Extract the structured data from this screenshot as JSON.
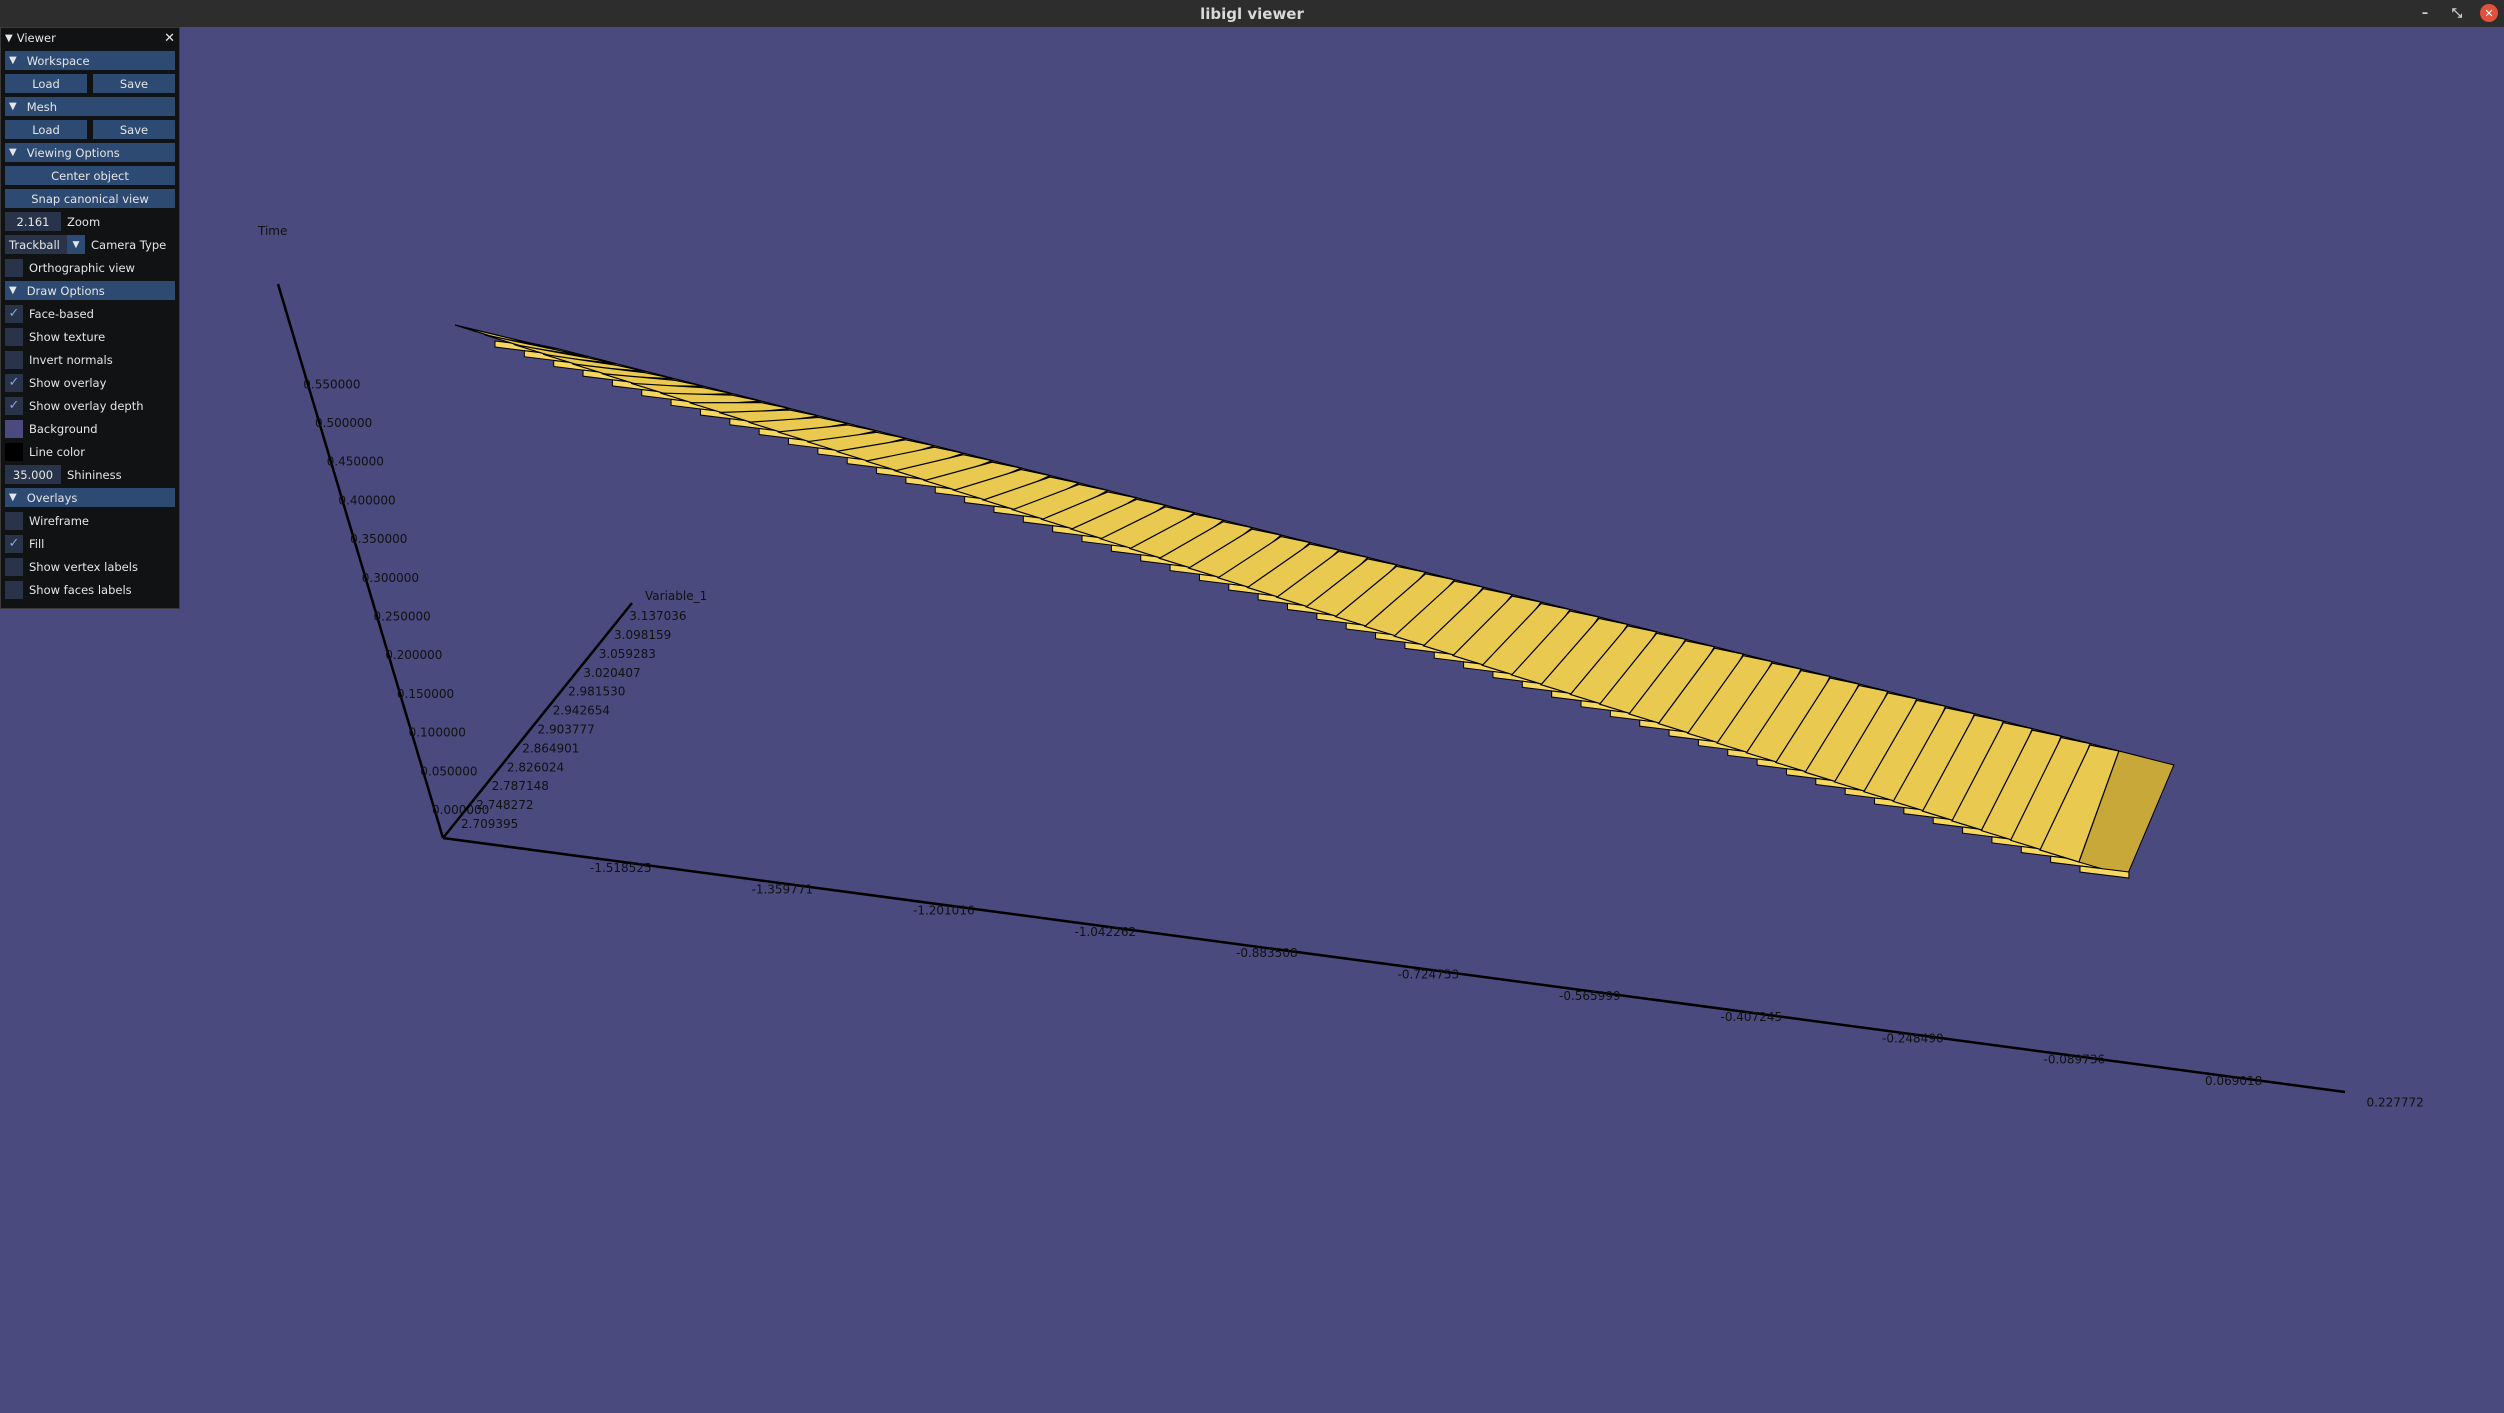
{
  "window": {
    "title": "libigl viewer"
  },
  "panel": {
    "title": "Viewer",
    "workspace": {
      "label": "Workspace",
      "load": "Load",
      "save": "Save"
    },
    "mesh": {
      "label": "Mesh",
      "load": "Load",
      "save": "Save"
    },
    "viewing": {
      "label": "Viewing Options",
      "center": "Center object",
      "snap": "Snap canonical view",
      "zoom_value": "2.161",
      "zoom_label": "Zoom",
      "camera_value": "Trackball",
      "camera_label": "Camera Type",
      "ortho": "Orthographic view"
    },
    "draw": {
      "label": "Draw Options",
      "face_based": "Face-based",
      "show_texture": "Show texture",
      "invert_normals": "Invert normals",
      "show_overlay": "Show overlay",
      "show_overlay_depth": "Show overlay depth",
      "background": "Background",
      "line_color": "Line color",
      "shininess_value": "35.000",
      "shininess_label": "Shininess",
      "background_color": "#4a4a7e",
      "line_color_value": "#000000"
    },
    "overlays": {
      "label": "Overlays",
      "wireframe": "Wireframe",
      "fill": "Fill",
      "vertex_labels": "Show vertex labels",
      "faces_labels": "Show faces labels"
    }
  },
  "scene": {
    "bar_color": "#e9c94f",
    "bar_count": 55,
    "axis_time": {
      "label": "Time",
      "ticks": [
        "0.000000",
        "0.050000",
        "0.100000",
        "0.150000",
        "0.200000",
        "0.250000",
        "0.300000",
        "0.350000",
        "0.400000",
        "0.450000",
        "0.500000",
        "0.550000"
      ]
    },
    "axis_variable": {
      "label": "Variable_1",
      "ticks": [
        "2.709395",
        "2.748272",
        "2.787148",
        "2.826024",
        "2.864901",
        "2.903777",
        "2.942654",
        "2.981530",
        "3.020407",
        "3.059283",
        "3.098159",
        "3.137036"
      ]
    },
    "axis_x": {
      "ticks": [
        "-1.518525",
        "-1.359771",
        "-1.201016",
        "-1.042262",
        "-0.883508",
        "-0.724753",
        "-0.565999",
        "-0.407245",
        "-0.248490",
        "-0.089736",
        "0.069018",
        "0.227772"
      ]
    }
  }
}
